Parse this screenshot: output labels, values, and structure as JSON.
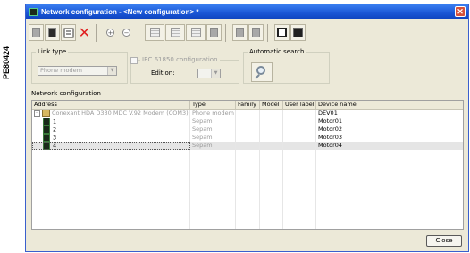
{
  "side_label": "PE80424",
  "window": {
    "title": "Network configuration - <New configuration> *",
    "close_glyph": "✕"
  },
  "toolbar": {
    "buttons": [
      {
        "icon": "document-icon"
      },
      {
        "icon": "dark-document-icon"
      },
      {
        "icon": "properties-icon"
      },
      {
        "icon": "delete-icon"
      },
      {
        "icon": "zoom-in-icon"
      },
      {
        "icon": "zoom-out-icon"
      },
      {
        "icon": "grid-icon"
      },
      {
        "icon": "grid-multi-icon"
      },
      {
        "icon": "grid-add-icon"
      },
      {
        "icon": "device-icon"
      },
      {
        "icon": "device-down-icon"
      },
      {
        "icon": "save-icon"
      },
      {
        "icon": "save-all-icon"
      }
    ]
  },
  "link_type": {
    "label": "Link type",
    "value": "Phone modem"
  },
  "iec": {
    "label": "IEC 61850 configuration",
    "edition_label": "Edition:",
    "edition_value": ""
  },
  "auto_search": {
    "label": "Automatic search"
  },
  "network": {
    "label": "Network configuration",
    "columns": [
      "Address",
      "Type",
      "Family",
      "Model",
      "User label",
      "Device name"
    ],
    "rows": [
      {
        "address": "Conexant HDA D330 MDC V.92 Modem (COM3)",
        "type": "Phone modem",
        "family": "",
        "model": "",
        "user_label": "",
        "device_name": "DEV01"
      },
      {
        "address": "1",
        "type": "Sepam",
        "family": "",
        "model": "",
        "user_label": "",
        "device_name": "Motor01"
      },
      {
        "address": "2",
        "type": "Sepam",
        "family": "",
        "model": "",
        "user_label": "",
        "device_name": "Motor02"
      },
      {
        "address": "3",
        "type": "Sepam",
        "family": "",
        "model": "",
        "user_label": "",
        "device_name": "Motor03"
      },
      {
        "address": "4",
        "type": "Sepam",
        "family": "",
        "model": "",
        "user_label": "",
        "device_name": "Motor04"
      }
    ]
  },
  "close_button": "Close",
  "colors": {
    "title_bar": "#1a56d6",
    "close_red": "#d6513a",
    "window_bg": "#ece9d8"
  }
}
